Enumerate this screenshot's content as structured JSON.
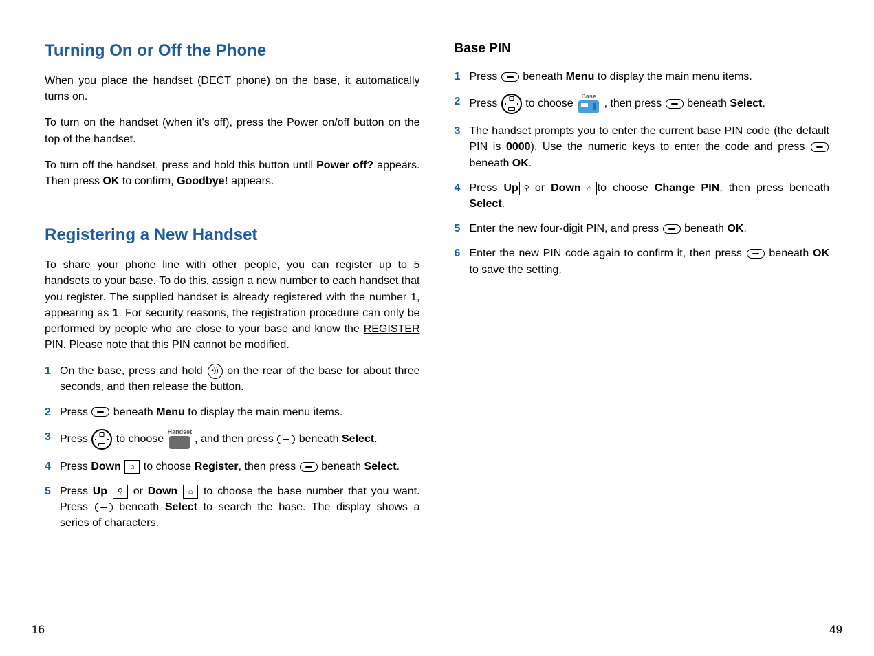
{
  "left": {
    "heading1": "Turning On or Off the Phone",
    "p1": "When you place the handset (DECT phone) on the base, it automatically turns on.",
    "p2": "To turn on the handset (when it's off), press the Power on/off button on the top of the handset.",
    "p3_a": "To turn off the handset, press and hold this button until ",
    "p3_b": "Power off?",
    "p3_c": " appears. Then press ",
    "p3_d": "OK",
    "p3_e": " to confirm, ",
    "p3_f": "Goodbye!",
    "p3_g": " appears.",
    "heading2": "Registering a New Handset",
    "p4_a": "To share your phone line with other people, you can register up to 5 handsets to your base. To do this, assign a new number to each handset that you register. The supplied handset is already registered with the number 1, appearing as ",
    "p4_b": "1",
    "p4_c": ". For security reasons, the registration procedure can only be performed by people who are close to your base and know the ",
    "p4_d": "REGISTER",
    "p4_e": " PIN. ",
    "p4_f": "Please note that this PIN cannot be modified.",
    "s1_a": "On the base, press and hold ",
    "s1_b": " on the rear of the base for about three seconds, and then release the button.",
    "s2_a": "Press ",
    "s2_b": " beneath ",
    "s2_c": "Menu",
    "s2_d": " to display the main menu items.",
    "s3_a": "Press ",
    "s3_b": " to choose ",
    "s3_c": " , and then press ",
    "s3_d": " beneath ",
    "s3_e": "Select",
    "s3_f": ".",
    "s3_icon_label": "Handset",
    "s4_a": "Press ",
    "s4_b": "Down",
    "s4_c": " to choose ",
    "s4_d": "Register",
    "s4_e": ", then press ",
    "s4_f": " beneath ",
    "s4_g": "Select",
    "s4_h": ".",
    "s5_a": "Press ",
    "s5_b": "Up",
    "s5_c": " or ",
    "s5_d": "Down",
    "s5_e": " to choose the base number that you want. Press ",
    "s5_f": " beneath ",
    "s5_g": "Select",
    "s5_h": " to search the base. The display shows a series of characters.",
    "nums": {
      "n1": "1",
      "n2": "2",
      "n3": "3",
      "n4": "4",
      "n5": "5"
    }
  },
  "right": {
    "heading": "Base PIN",
    "s1_a": "Press ",
    "s1_b": " beneath ",
    "s1_c": "Menu",
    "s1_d": " to display the main menu items.",
    "s2_a": "Press ",
    "s2_b": " to choose ",
    "s2_c": " , then press ",
    "s2_d": " beneath ",
    "s2_e": "Select",
    "s2_f": ".",
    "s2_icon_label": "Base",
    "s3_a": "The handset prompts you to enter the current base PIN code (the default PIN is ",
    "s3_b": "0000",
    "s3_c": "). Use the numeric keys to enter the code and press ",
    "s3_d": " beneath ",
    "s3_e": "OK",
    "s3_f": ".",
    "s4_a": "Press ",
    "s4_b": "Up",
    "s4_c": "or ",
    "s4_d": "Down",
    "s4_e": "to choose ",
    "s4_f": "Change PIN",
    "s4_g": ", then press beneath ",
    "s4_h": "Select",
    "s4_i": ".",
    "s5_a": "Enter the new four-digit PIN, and press ",
    "s5_b": " beneath ",
    "s5_c": "OK",
    "s5_d": ".",
    "s6_a": "Enter the new PIN code again to confirm it, then press ",
    "s6_b": " beneath  ",
    "s6_c": "OK",
    "s6_d": " to save the setting.",
    "nums": {
      "n1": "1",
      "n2": "2",
      "n3": "3",
      "n4": "4",
      "n5": "5",
      "n6": "6"
    }
  },
  "pages": {
    "left": "16",
    "right": "49"
  }
}
